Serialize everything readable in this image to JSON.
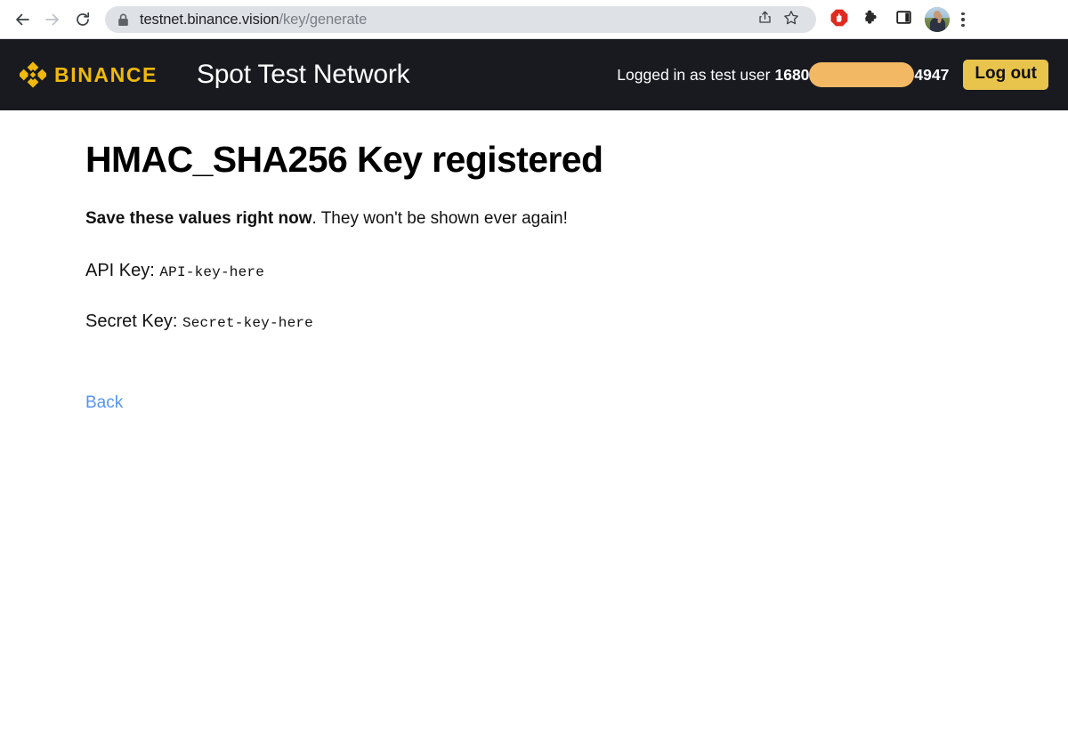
{
  "browser": {
    "nav": {
      "back_icon": "arrow-left-icon",
      "forward_icon": "arrow-right-icon",
      "reload_icon": "reload-icon"
    },
    "omnibox": {
      "lock_icon": "lock-icon",
      "url_domain": "testnet.binance.vision",
      "url_path": "/key/generate",
      "share_icon": "share-icon",
      "bookmark_icon": "star-icon"
    },
    "extensions": [
      {
        "name": "adblock-icon",
        "label": "AdBlock"
      },
      {
        "name": "puzzle-icon",
        "label": "Extensions"
      },
      {
        "name": "sidepanel-icon",
        "label": "Side panel"
      }
    ],
    "avatar": {
      "name": "profile-avatar",
      "label": "Profile"
    },
    "menu_icon": "three-dot-menu-icon"
  },
  "site_header": {
    "brand_mark": "binance-diamond-logo",
    "brand_word": "BINANCE",
    "title": "Spot Test Network",
    "status_prefix": "Logged in as test user",
    "user_id_prefix": "1680",
    "user_id_suffix": "4947",
    "redaction": "redacted-user-id",
    "logout_label": "Log out"
  },
  "page": {
    "title": "HMAC_SHA256 Key registered",
    "warning_strong": "Save these values right now",
    "warning_rest": ". They won't be shown ever again!",
    "api_key_label": "API Key:",
    "api_key_value": "API-key-here",
    "secret_key_label": "Secret Key:",
    "secret_key_value": "Secret-key-here",
    "back_label": "Back"
  },
  "colors": {
    "header_bg": "#181a20",
    "brand_yellow": "#f0b90b",
    "logout_yellow": "#e9c44c",
    "redaction_orange": "#f3b864",
    "link_blue": "#5596f0",
    "omnibox_bg": "#dee1e6"
  }
}
